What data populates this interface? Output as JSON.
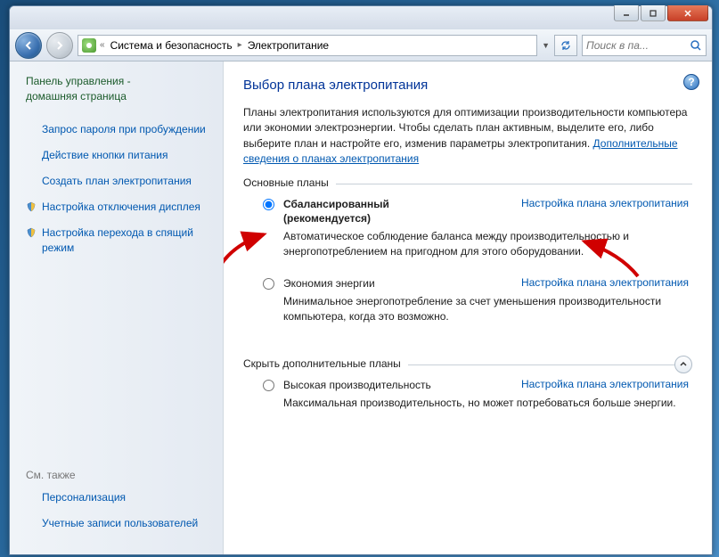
{
  "window": {
    "titlebar": {}
  },
  "nav": {
    "breadcrumb": {
      "item1": "Система и безопасность",
      "item2": "Электропитание"
    },
    "search_placeholder": "Поиск в па..."
  },
  "sidebar": {
    "home_line1": "Панель управления -",
    "home_line2": "домашняя страница",
    "links": [
      {
        "label": "Запрос пароля при пробуждении",
        "icon": null
      },
      {
        "label": "Действие кнопки питания",
        "icon": null
      },
      {
        "label": "Создать план электропитания",
        "icon": null
      },
      {
        "label": "Настройка отключения дисплея",
        "icon": "monitor"
      },
      {
        "label": "Настройка перехода в спящий режим",
        "icon": "moon"
      }
    ],
    "see_also_title": "См. также",
    "see_also": [
      {
        "label": "Персонализация"
      },
      {
        "label": "Учетные записи пользователей"
      }
    ]
  },
  "main": {
    "heading": "Выбор плана электропитания",
    "description": "Планы электропитания используются для оптимизации производительности компьютера или экономии электроэнергии. Чтобы сделать план активным, выделите его, либо выберите план и настройте его, изменив параметры электропитания. ",
    "description_link": "Дополнительные сведения о планах электропитания",
    "group1_title": "Основные планы",
    "group2_title": "Скрыть дополнительные планы",
    "change_settings_link": "Настройка плана электропитания",
    "plans": {
      "balanced": {
        "title": "Сбалансированный",
        "subtitle": "(рекомендуется)",
        "desc": "Автоматическое соблюдение баланса между производительностью и энергопотреблением на пригодном для этого оборудовании."
      },
      "saver": {
        "title": "Экономия энергии",
        "desc": "Минимальное энергопотребление за счет уменьшения производительности компьютера, когда это возможно."
      },
      "high": {
        "title": "Высокая производительность",
        "desc": "Максимальная производительность, но может потребоваться больше энергии."
      }
    }
  }
}
